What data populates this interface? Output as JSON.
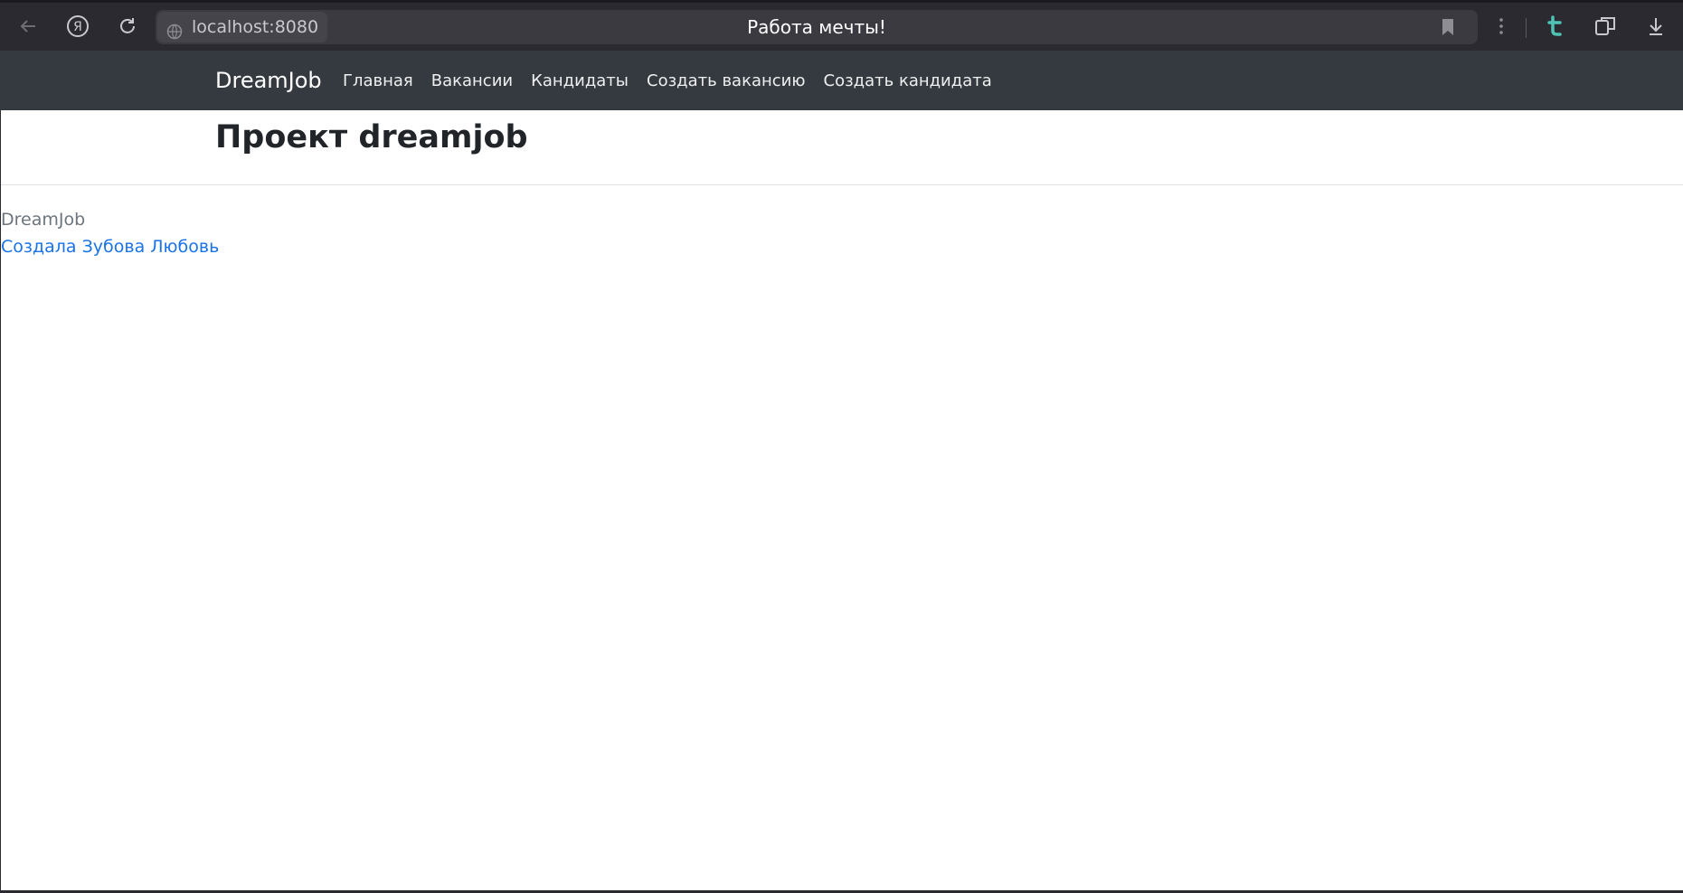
{
  "browser": {
    "url": "localhost:8080",
    "tab_title": "Работа мечты!",
    "icons": [
      "back-arrow-icon",
      "yandex-icon",
      "reload-icon",
      "globe-icon",
      "bookmark-icon",
      "more-icon",
      "translate-icon",
      "tabs-icon",
      "download-icon"
    ]
  },
  "navbar": {
    "brand": "DreamJob",
    "links": [
      "Главная",
      "Вакансии",
      "Кандидаты",
      "Создать вакансию",
      "Создать кандидата"
    ],
    "background": "#343a40"
  },
  "main": {
    "title": "Проект dreamjob"
  },
  "footer": {
    "brand": "DreamJob",
    "author": "Создала Зубова Любовь",
    "author_color": "#1a73e8"
  }
}
